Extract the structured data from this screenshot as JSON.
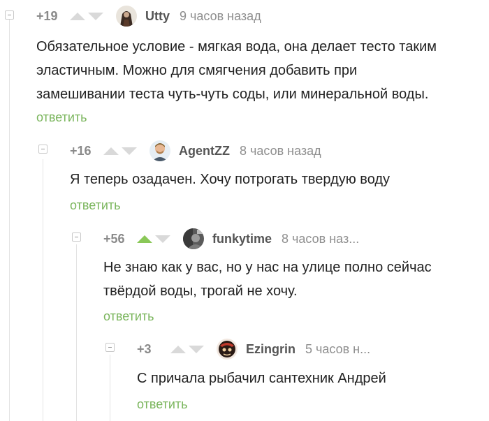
{
  "comments": [
    {
      "rating": "+19",
      "username": "Utty",
      "time": "9 часов назад",
      "text_lines": [
        "Обязательное условие - мягкая вода, она делает тесто таким",
        "эластичным. Можно для смягчения добавить при",
        "замешивании теста чуть-чуть соды, или минеральной воды."
      ],
      "reply": "ответить",
      "upvoted": false
    },
    {
      "rating": "+16",
      "username": "AgentZZ",
      "time": "8 часов назад",
      "text_lines": [
        "Я теперь озадачен. Хочу потрогать твердую воду"
      ],
      "reply": "ответить",
      "upvoted": false
    },
    {
      "rating": "+56",
      "username": "funkytime",
      "time": "8 часов наз...",
      "text_lines": [
        "Не знаю как у вас, но у нас на улице полно сейчас",
        "твёрдой воды, трогай не хочу."
      ],
      "reply": "ответить",
      "upvoted": true
    },
    {
      "rating": "+3",
      "username": "Ezingrin",
      "time": "5 часов н...",
      "text_lines": [
        "С причала рыбачил сантехник Андрей"
      ],
      "reply": "ответить",
      "upvoted": false
    }
  ],
  "colors": {
    "reply_link": "#7ab55c",
    "upvote_active": "#8ac858",
    "arrow_inactive": "#d9d9d9"
  }
}
